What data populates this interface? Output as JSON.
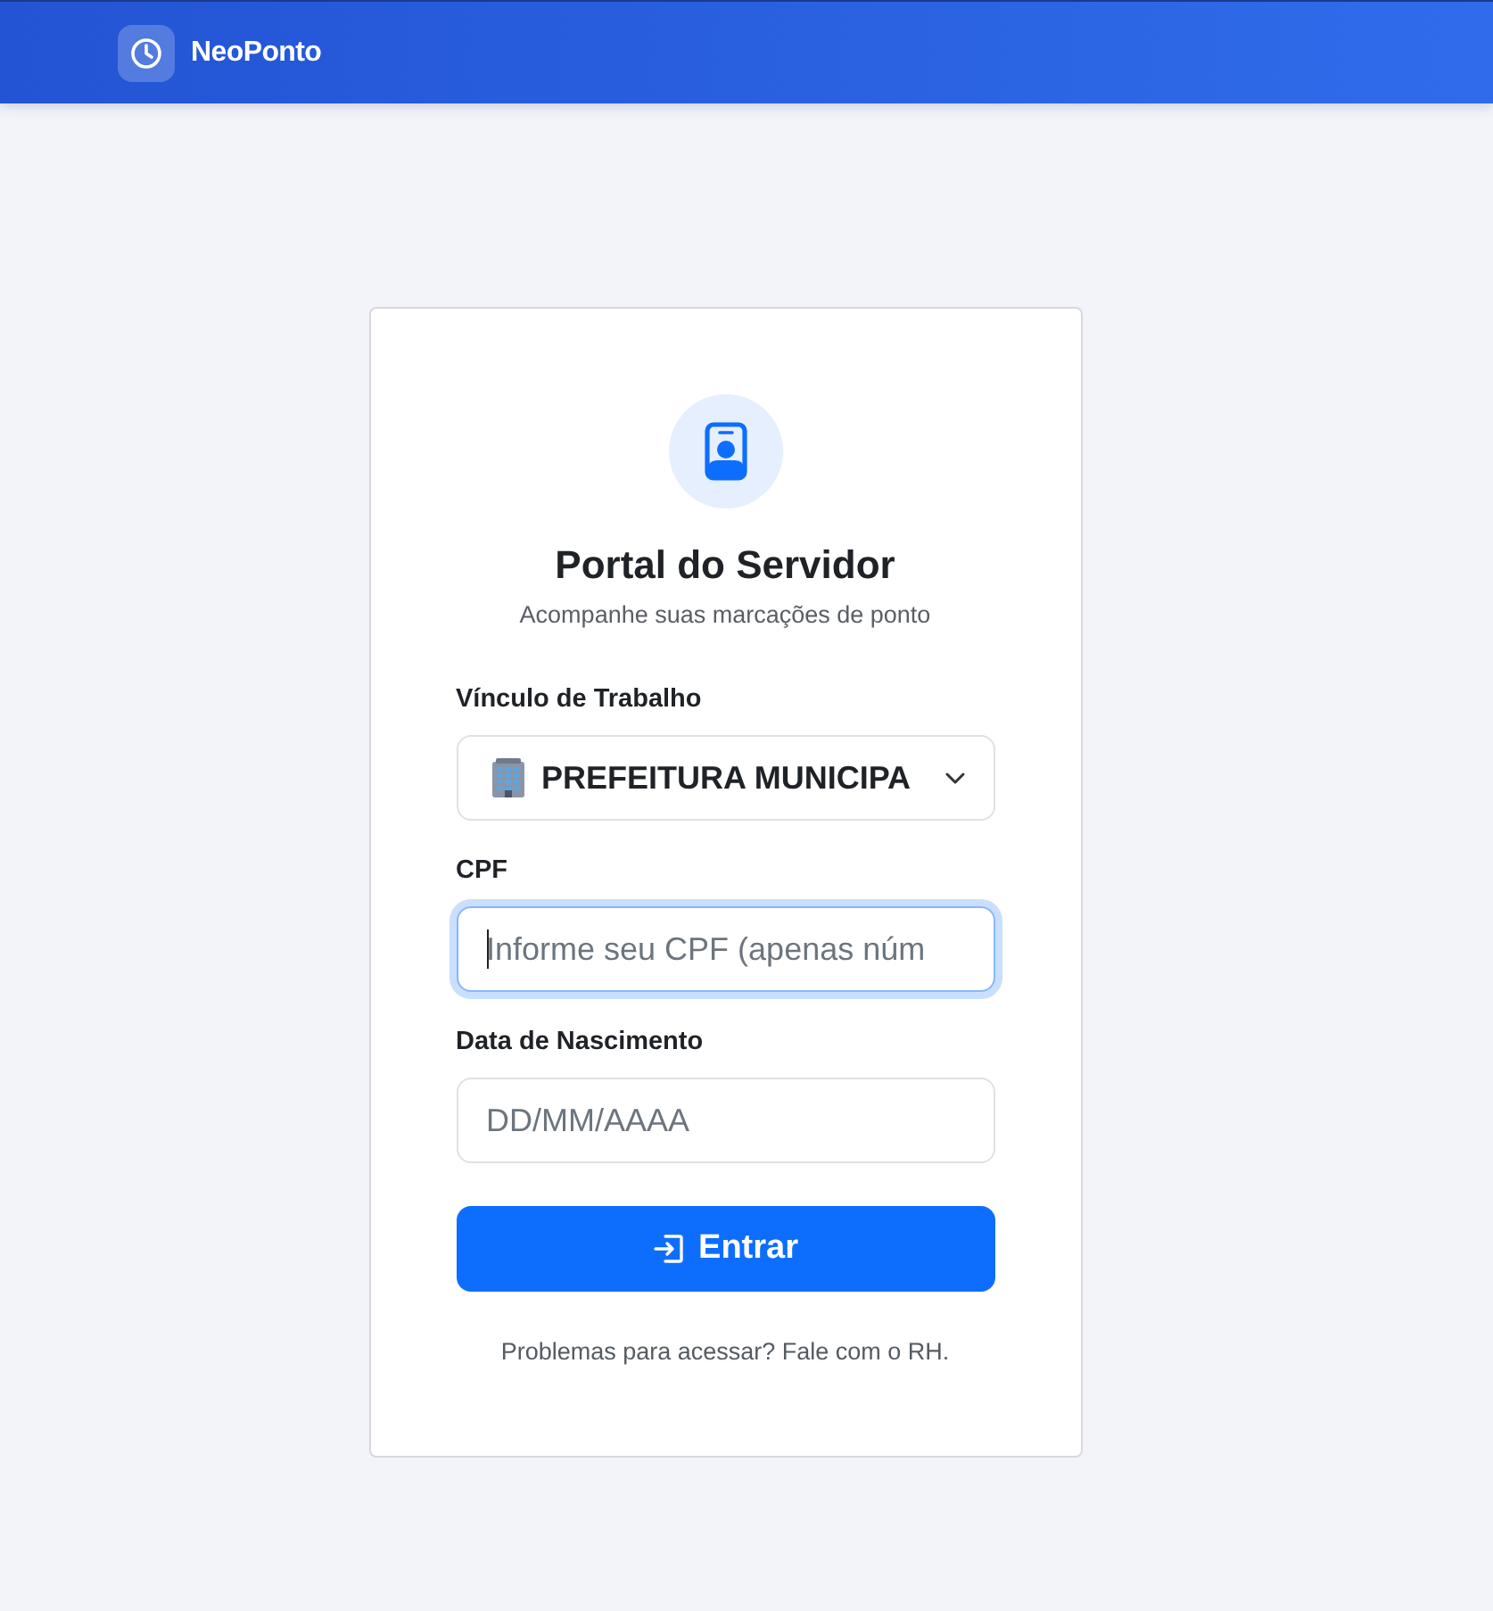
{
  "header": {
    "brand": "NeoPonto"
  },
  "card": {
    "title": "Portal do Servidor",
    "subtitle": "Acompanhe suas marcações de ponto"
  },
  "fields": [
    {
      "kind": "select",
      "label": "Vínculo de Trabalho",
      "value": "PREFEITURA MUNICIPA",
      "focused": false
    },
    {
      "kind": "input",
      "label": "CPF",
      "placeholder": "Informe seu CPF (apenas núm",
      "focused": true
    },
    {
      "kind": "input",
      "label": "Data de Nascimento",
      "placeholder": "DD/MM/AAAA",
      "focused": false
    }
  ],
  "submit": {
    "label": "Entrar"
  },
  "help": "Problemas para acessar? Fale com o RH."
}
